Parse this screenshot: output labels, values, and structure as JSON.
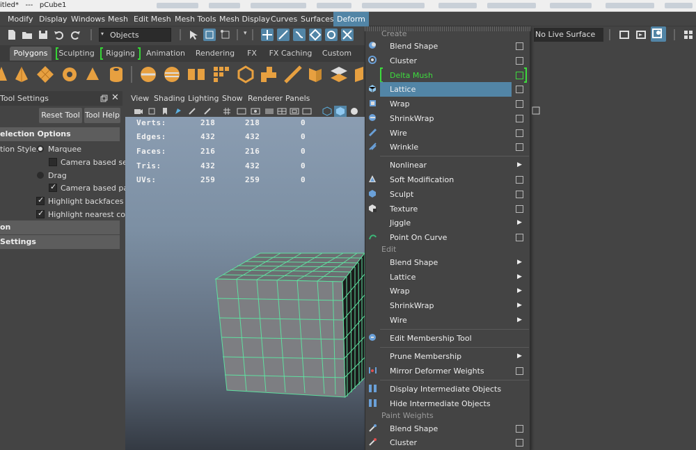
{
  "window": {
    "title": "itled*   ---   pCube1"
  },
  "menubar": {
    "items": [
      "Modify",
      "Display",
      "Windows",
      "Mesh",
      "Edit Mesh",
      "Mesh Tools",
      "Mesh Display",
      "Curves",
      "Surfaces",
      "Deform"
    ],
    "active": "Deform"
  },
  "statusline": {
    "selection_mode": "Objects",
    "live_surface": "No Live Surface"
  },
  "shelf": {
    "tabs": [
      "Polygons",
      "Sculpting",
      "Rigging",
      "Animation",
      "Rendering",
      "FX",
      "FX Caching",
      "Custom"
    ],
    "active_tab": "Polygons"
  },
  "tool_settings": {
    "title": "Tool Settings",
    "reset_label": "Reset Tool",
    "help_label": "Tool Help",
    "section_selection": "election Options",
    "selection_style_label": "tion Style:",
    "marquee_label": "Marquee",
    "camera_based_sel_label": "Camera based sel",
    "drag_label": "Drag",
    "camera_based_paint_label": "Camera based pai",
    "highlight_backfaces_label": "Highlight backfaces",
    "highlight_nearest_label": "Highlight nearest com",
    "section_on": "on",
    "section_settings": "Settings"
  },
  "viewport": {
    "menus": [
      "View",
      "Shading",
      "Lighting",
      "Show",
      "Renderer",
      "Panels"
    ],
    "hud": [
      {
        "label": "Verts:",
        "a": "218",
        "b": "218",
        "c": "0"
      },
      {
        "label": "Edges:",
        "a": "432",
        "b": "432",
        "c": "0"
      },
      {
        "label": "Faces:",
        "a": "216",
        "b": "216",
        "c": "0"
      },
      {
        "label": "Tris:",
        "a": "432",
        "b": "432",
        "c": "0"
      },
      {
        "label": "UVs:",
        "a": "259",
        "b": "259",
        "c": "0"
      }
    ]
  },
  "deform_menu": {
    "header_create": "Create",
    "create": [
      {
        "label": "Blend Shape",
        "suffix": "box"
      },
      {
        "label": "Cluster",
        "suffix": "box"
      },
      {
        "label": "Delta Mush",
        "suffix": "box"
      },
      {
        "label": "Lattice",
        "suffix": "box"
      },
      {
        "label": "Wrap",
        "suffix": "box"
      },
      {
        "label": "ShrinkWrap",
        "suffix": "box"
      },
      {
        "label": "Wire",
        "suffix": "box"
      },
      {
        "label": "Wrinkle",
        "suffix": "box"
      },
      {
        "label": "Nonlinear",
        "suffix": "arrow"
      },
      {
        "label": "Soft Modification",
        "suffix": "box"
      },
      {
        "label": "Sculpt",
        "suffix": "box"
      },
      {
        "label": "Texture",
        "suffix": "box"
      },
      {
        "label": "Jiggle",
        "suffix": "arrow"
      },
      {
        "label": "Point On Curve",
        "suffix": "box"
      }
    ],
    "header_edit": "Edit",
    "edit": [
      {
        "label": "Blend Shape",
        "suffix": "arrow"
      },
      {
        "label": "Lattice",
        "suffix": "arrow"
      },
      {
        "label": "Wrap",
        "suffix": "arrow"
      },
      {
        "label": "ShrinkWrap",
        "suffix": "arrow"
      },
      {
        "label": "Wire",
        "suffix": "arrow"
      },
      {
        "label": "Edit Membership Tool",
        "suffix": "none"
      },
      {
        "label": "Prune Membership",
        "suffix": "arrow"
      },
      {
        "label": "Mirror Deformer Weights",
        "suffix": "box"
      },
      {
        "label": "Display Intermediate Objects",
        "suffix": "none"
      },
      {
        "label": "Hide Intermediate Objects",
        "suffix": "none"
      }
    ],
    "header_paint": "Paint Weights",
    "paint": [
      {
        "label": "Blend Shape",
        "suffix": "box"
      },
      {
        "label": "Cluster",
        "suffix": "box"
      }
    ],
    "highlighted": "Lattice",
    "green_item": "Delta Mush"
  },
  "colors": {
    "accent": "#5285a6",
    "mesh_wire": "#5fe0a0",
    "green": "#3ddc3d"
  }
}
